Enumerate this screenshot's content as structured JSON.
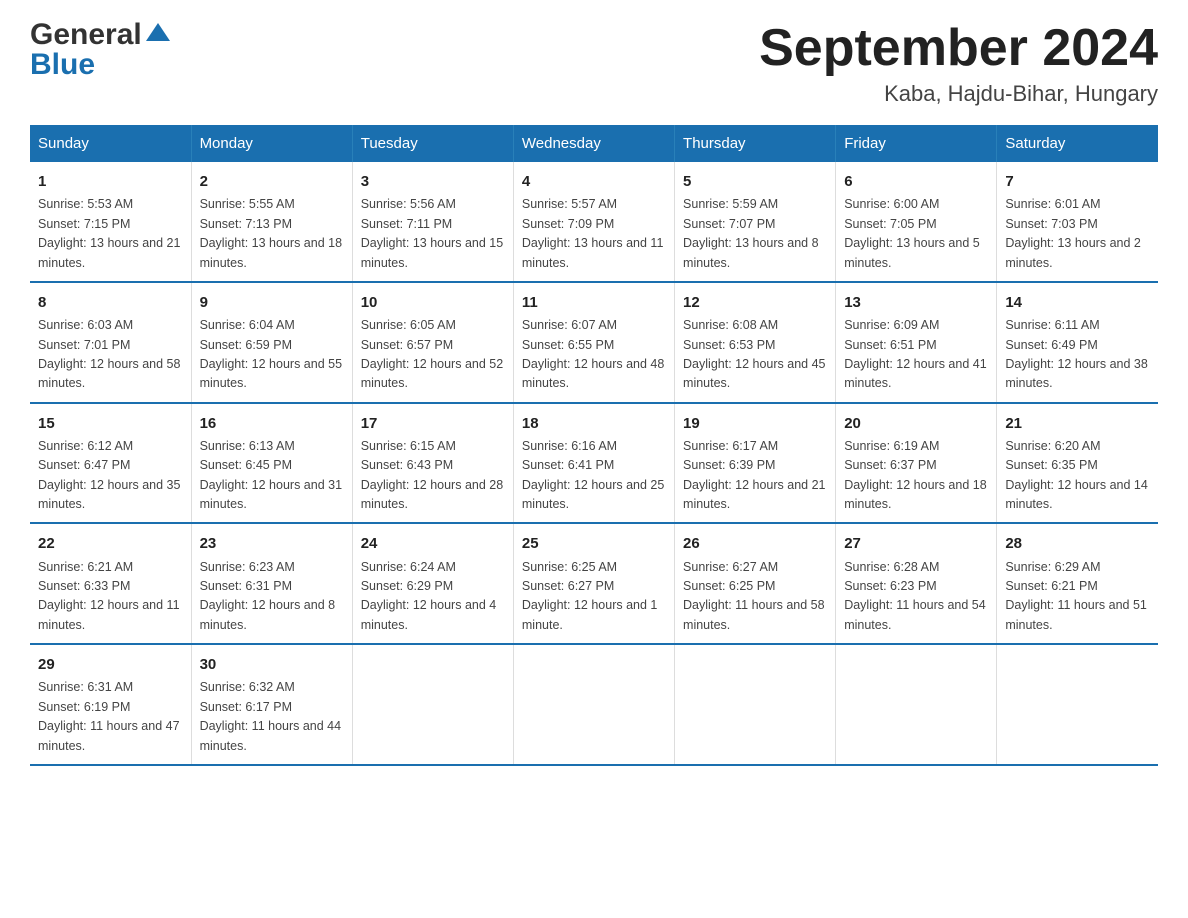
{
  "header": {
    "title": "September 2024",
    "subtitle": "Kaba, Hajdu-Bihar, Hungary",
    "logo_general": "General",
    "logo_blue": "Blue"
  },
  "weekdays": [
    "Sunday",
    "Monday",
    "Tuesday",
    "Wednesday",
    "Thursday",
    "Friday",
    "Saturday"
  ],
  "weeks": [
    [
      {
        "day": "1",
        "sunrise": "Sunrise: 5:53 AM",
        "sunset": "Sunset: 7:15 PM",
        "daylight": "Daylight: 13 hours and 21 minutes."
      },
      {
        "day": "2",
        "sunrise": "Sunrise: 5:55 AM",
        "sunset": "Sunset: 7:13 PM",
        "daylight": "Daylight: 13 hours and 18 minutes."
      },
      {
        "day": "3",
        "sunrise": "Sunrise: 5:56 AM",
        "sunset": "Sunset: 7:11 PM",
        "daylight": "Daylight: 13 hours and 15 minutes."
      },
      {
        "day": "4",
        "sunrise": "Sunrise: 5:57 AM",
        "sunset": "Sunset: 7:09 PM",
        "daylight": "Daylight: 13 hours and 11 minutes."
      },
      {
        "day": "5",
        "sunrise": "Sunrise: 5:59 AM",
        "sunset": "Sunset: 7:07 PM",
        "daylight": "Daylight: 13 hours and 8 minutes."
      },
      {
        "day": "6",
        "sunrise": "Sunrise: 6:00 AM",
        "sunset": "Sunset: 7:05 PM",
        "daylight": "Daylight: 13 hours and 5 minutes."
      },
      {
        "day": "7",
        "sunrise": "Sunrise: 6:01 AM",
        "sunset": "Sunset: 7:03 PM",
        "daylight": "Daylight: 13 hours and 2 minutes."
      }
    ],
    [
      {
        "day": "8",
        "sunrise": "Sunrise: 6:03 AM",
        "sunset": "Sunset: 7:01 PM",
        "daylight": "Daylight: 12 hours and 58 minutes."
      },
      {
        "day": "9",
        "sunrise": "Sunrise: 6:04 AM",
        "sunset": "Sunset: 6:59 PM",
        "daylight": "Daylight: 12 hours and 55 minutes."
      },
      {
        "day": "10",
        "sunrise": "Sunrise: 6:05 AM",
        "sunset": "Sunset: 6:57 PM",
        "daylight": "Daylight: 12 hours and 52 minutes."
      },
      {
        "day": "11",
        "sunrise": "Sunrise: 6:07 AM",
        "sunset": "Sunset: 6:55 PM",
        "daylight": "Daylight: 12 hours and 48 minutes."
      },
      {
        "day": "12",
        "sunrise": "Sunrise: 6:08 AM",
        "sunset": "Sunset: 6:53 PM",
        "daylight": "Daylight: 12 hours and 45 minutes."
      },
      {
        "day": "13",
        "sunrise": "Sunrise: 6:09 AM",
        "sunset": "Sunset: 6:51 PM",
        "daylight": "Daylight: 12 hours and 41 minutes."
      },
      {
        "day": "14",
        "sunrise": "Sunrise: 6:11 AM",
        "sunset": "Sunset: 6:49 PM",
        "daylight": "Daylight: 12 hours and 38 minutes."
      }
    ],
    [
      {
        "day": "15",
        "sunrise": "Sunrise: 6:12 AM",
        "sunset": "Sunset: 6:47 PM",
        "daylight": "Daylight: 12 hours and 35 minutes."
      },
      {
        "day": "16",
        "sunrise": "Sunrise: 6:13 AM",
        "sunset": "Sunset: 6:45 PM",
        "daylight": "Daylight: 12 hours and 31 minutes."
      },
      {
        "day": "17",
        "sunrise": "Sunrise: 6:15 AM",
        "sunset": "Sunset: 6:43 PM",
        "daylight": "Daylight: 12 hours and 28 minutes."
      },
      {
        "day": "18",
        "sunrise": "Sunrise: 6:16 AM",
        "sunset": "Sunset: 6:41 PM",
        "daylight": "Daylight: 12 hours and 25 minutes."
      },
      {
        "day": "19",
        "sunrise": "Sunrise: 6:17 AM",
        "sunset": "Sunset: 6:39 PM",
        "daylight": "Daylight: 12 hours and 21 minutes."
      },
      {
        "day": "20",
        "sunrise": "Sunrise: 6:19 AM",
        "sunset": "Sunset: 6:37 PM",
        "daylight": "Daylight: 12 hours and 18 minutes."
      },
      {
        "day": "21",
        "sunrise": "Sunrise: 6:20 AM",
        "sunset": "Sunset: 6:35 PM",
        "daylight": "Daylight: 12 hours and 14 minutes."
      }
    ],
    [
      {
        "day": "22",
        "sunrise": "Sunrise: 6:21 AM",
        "sunset": "Sunset: 6:33 PM",
        "daylight": "Daylight: 12 hours and 11 minutes."
      },
      {
        "day": "23",
        "sunrise": "Sunrise: 6:23 AM",
        "sunset": "Sunset: 6:31 PM",
        "daylight": "Daylight: 12 hours and 8 minutes."
      },
      {
        "day": "24",
        "sunrise": "Sunrise: 6:24 AM",
        "sunset": "Sunset: 6:29 PM",
        "daylight": "Daylight: 12 hours and 4 minutes."
      },
      {
        "day": "25",
        "sunrise": "Sunrise: 6:25 AM",
        "sunset": "Sunset: 6:27 PM",
        "daylight": "Daylight: 12 hours and 1 minute."
      },
      {
        "day": "26",
        "sunrise": "Sunrise: 6:27 AM",
        "sunset": "Sunset: 6:25 PM",
        "daylight": "Daylight: 11 hours and 58 minutes."
      },
      {
        "day": "27",
        "sunrise": "Sunrise: 6:28 AM",
        "sunset": "Sunset: 6:23 PM",
        "daylight": "Daylight: 11 hours and 54 minutes."
      },
      {
        "day": "28",
        "sunrise": "Sunrise: 6:29 AM",
        "sunset": "Sunset: 6:21 PM",
        "daylight": "Daylight: 11 hours and 51 minutes."
      }
    ],
    [
      {
        "day": "29",
        "sunrise": "Sunrise: 6:31 AM",
        "sunset": "Sunset: 6:19 PM",
        "daylight": "Daylight: 11 hours and 47 minutes."
      },
      {
        "day": "30",
        "sunrise": "Sunrise: 6:32 AM",
        "sunset": "Sunset: 6:17 PM",
        "daylight": "Daylight: 11 hours and 44 minutes."
      },
      null,
      null,
      null,
      null,
      null
    ]
  ]
}
